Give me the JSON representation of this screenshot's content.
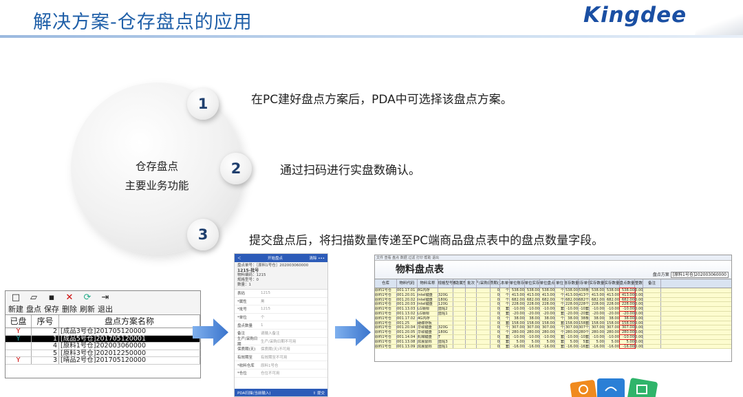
{
  "header": {
    "title": "解决方案-仓存盘点的应用",
    "brand": "Kingdee"
  },
  "circle": {
    "line1": "仓存盘点",
    "line2": "主要业务功能"
  },
  "steps": [
    {
      "num": "1",
      "text": "在PC建好盘点方案后，PDA中可选择该盘点方案。"
    },
    {
      "num": "2",
      "text": "通过扫码进行实盘数确认。"
    },
    {
      "num": "3",
      "text": "提交盘点后，将扫描数量传递至PC端商品盘点表中的盘点数量字段。"
    }
  ],
  "pc": {
    "toolbar": [
      {
        "icon": "□",
        "label": "新建"
      },
      {
        "icon": "▱",
        "label": "盘点"
      },
      {
        "icon": "▪",
        "label": "保存"
      },
      {
        "icon": "✕",
        "label": "删除"
      },
      {
        "icon": "⟳",
        "label": "刷新"
      },
      {
        "icon": "⇥",
        "label": "退出"
      }
    ],
    "columns": [
      "已盘",
      "序号",
      "盘点方案名称"
    ],
    "rows": [
      {
        "flag": "Y",
        "no": "2",
        "name": "[成品3号仓]201705120000",
        "sel": false
      },
      {
        "flag": "Y",
        "no": "1",
        "name": "[成品5号仓]201705120001",
        "sel": true
      },
      {
        "flag": "",
        "no": "4",
        "name": "[原料1号仓]202003060000",
        "sel": false
      },
      {
        "flag": "",
        "no": "5",
        "name": "[原料3号仓]202012250000",
        "sel": false
      },
      {
        "flag": "Y",
        "no": "3",
        "name": "[晴品2号仓]201705120000",
        "sel": false
      }
    ]
  },
  "phone": {
    "back": "＜",
    "title": "开始盘点",
    "right1": "清除",
    "right2": "•••",
    "info": [
      "盘点单号：［原料1号仓］202003060000",
      "1215-批号",
      "物料编码：1215",
      "规格型号：0",
      "数量：1"
    ],
    "fields": [
      {
        "k": "表码",
        "v": "1215"
      },
      {
        "k": "*属性",
        "v": "黑"
      },
      {
        "k": "*批号",
        "v": "1215"
      },
      {
        "k": "*单位",
        "v": "个"
      },
      {
        "k": "盘点数量",
        "v": "1"
      },
      {
        "k": "备注",
        "v": "请输入备注"
      },
      {
        "k": "生产/采购日期",
        "v": "生产/采购日期不可用"
      },
      {
        "k": "保质期(天)",
        "v": "保质期(天)不可用"
      },
      {
        "k": "有效期至",
        "v": "有效期至不可用"
      },
      {
        "k": "*收料仓库",
        "v": "原料1号仓"
      },
      {
        "k": "*仓位",
        "v": "仓位不可用"
      }
    ],
    "bottom_left": "PDA扫描(当前输入)",
    "bottom_right": "提交"
  },
  "grid": {
    "menu": "文件  查看  盘点  数据  过滤  打印  帮助  退出",
    "title": "物料盘点表",
    "scheme_label": "盘点方案",
    "scheme_value": "[原料1号仓]202003060000",
    "columns": [
      "仓库",
      "物料代码",
      "物料名称",
      "规格型号",
      "辅助属性",
      "批次",
      "生产/采购日期",
      "保质期(天)",
      "基本单位",
      "基本单位账存数量",
      "基本单位实存数量",
      "基本单位盘点数量",
      "单位",
      "账存数量",
      "账存单位",
      "实存数量",
      "实存数量",
      "盘点数量",
      "调整数量",
      "备注"
    ],
    "rows": [
      [
        "原料1号仓",
        "001.17.01",
        "8G内存",
        "",
        "",
        "",
        "",
        "0",
        "个",
        "538.00",
        "538.00",
        "538.00",
        "个",
        "538.00",
        "538条",
        "538.00",
        "538.00",
        "538.00",
        "0.00",
        ""
      ],
      [
        "原料1号仓",
        "001.20.01",
        "Intel键盘",
        "320G",
        "",
        "",
        "",
        "0",
        "个",
        "413.00",
        "413.00",
        "413.00",
        "个",
        "413.00",
        "413个",
        "413.00",
        "413.00",
        "413.00",
        "0.00",
        ""
      ],
      [
        "原料1号仓",
        "001.20.02",
        "Intel键盘",
        "180G",
        "",
        "",
        "",
        "0",
        "个",
        "682.00",
        "682.00",
        "682.00",
        "个",
        "682.00",
        "682个",
        "682.00",
        "682.00",
        "682.00",
        "0.00",
        ""
      ],
      [
        "原料1号仓",
        "001.20.03",
        "Intel键盘",
        "120G",
        "",
        "",
        "",
        "0",
        "个",
        "228.00",
        "228.00",
        "228.00",
        "个",
        "228.00",
        "228个",
        "228.00",
        "228.00",
        "228.00",
        "0.00",
        ""
      ],
      [
        "原料1号仓",
        "001.13.03",
        "LG锁标",
        "蓝帖2",
        "",
        "",
        "",
        "0",
        "套",
        "-10.00",
        "-10.00",
        "-10.00",
        "套",
        "-10.00",
        "-10套",
        "-10.00",
        "-10.00",
        "-10.00",
        "0.00",
        ""
      ],
      [
        "原料1号仓",
        "001.13.02",
        "LG锁标",
        "蓝帖1",
        "",
        "",
        "",
        "0",
        "套",
        "-20.00",
        "-20.00",
        "-20.00",
        "套",
        "-20.00",
        "-20套",
        "-20.00",
        "-20.00",
        "-20.00",
        "0.00",
        ""
      ],
      [
        "原料1号仓",
        "001.17.02",
        "4G内存",
        "",
        "",
        "",
        "",
        "0",
        "个",
        "38.00",
        "38.00",
        "38.00",
        "个",
        "38.00",
        "38条",
        "38.00",
        "38.00",
        "38.00",
        "0.00",
        ""
      ],
      [
        "原料1号仓",
        "001.25",
        "硬碟存板",
        "",
        "",
        "",
        "",
        "0",
        "套",
        "158.00",
        "158.00",
        "158.00",
        "套",
        "158.00",
        "158套",
        "158.00",
        "158.00",
        "158.00",
        "0.00",
        ""
      ],
      [
        "原料1号仓",
        "001.20.04",
        "华硕键盘",
        "320G",
        "",
        "",
        "",
        "0",
        "个",
        "307.00",
        "307.00",
        "307.00",
        "个",
        "307.00",
        "307个",
        "307.00",
        "307.00",
        "307.00",
        "0.00",
        ""
      ],
      [
        "原料1号仓",
        "001.20.05",
        "华硕键盘",
        "180G",
        "",
        "",
        "",
        "0",
        "个",
        "280.00",
        "280.00",
        "280.00",
        "个",
        "280.00",
        "280个",
        "280.00",
        "280.00",
        "280.00",
        "0.00",
        ""
      ],
      [
        "原料1号仓",
        "001.14.04",
        "机械键盘",
        "T",
        "",
        "",
        "",
        "0",
        "套",
        "-10.00",
        "-10.00",
        "-10.00",
        "套",
        "-10.00",
        "-10套",
        "-10.00",
        "-10.00",
        "-10.00",
        "0.00",
        ""
      ],
      [
        "原料1号仓",
        "001.13.08",
        "炫晨鼠标",
        "蓝帖3",
        "",
        "",
        "",
        "0",
        "套",
        "5.00",
        "5.00",
        "5.00",
        "套",
        "5.00",
        "5套",
        "5.00",
        "5.00",
        "5.00",
        "0.00",
        ""
      ],
      [
        "原料1号仓",
        "001.13.09",
        "炫晨鼠标",
        "蓝帖1",
        "",
        "",
        "",
        "0",
        "套",
        "-16.00",
        "-16.00",
        "-16.00",
        "套",
        "-16.00",
        "-16套",
        "-16.00",
        "-16.00",
        "-16.00",
        "0.00",
        ""
      ]
    ]
  },
  "colors": {
    "title": "#1f5fa8",
    "brand": "#1a4fa3",
    "arrow": "#4a86d8",
    "num": "#1f3f6e"
  }
}
